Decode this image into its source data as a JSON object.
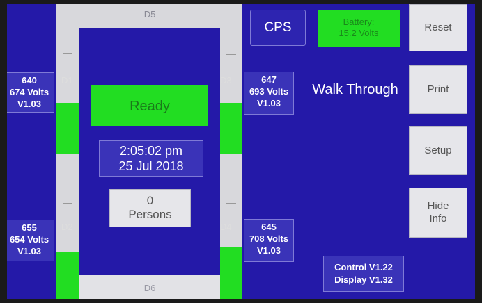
{
  "header": {
    "cps_label": "CPS",
    "battery_line1": "Battery:",
    "battery_line2": "15.2 Volts"
  },
  "status": {
    "ready_label": "Ready",
    "time": "2:05:02 pm",
    "date": "25 Jul 2018",
    "persons_count": "0",
    "persons_label": "Persons",
    "mode_label": "Walk Through"
  },
  "detectors": {
    "d1": {
      "label": "D1",
      "id": "640",
      "volts": "674 Volts",
      "version": "V1.03"
    },
    "d2": {
      "label": "D2",
      "id": "655",
      "volts": "654 Volts",
      "version": "V1.03"
    },
    "d3": {
      "label": "D3",
      "id": "647",
      "volts": "693 Volts",
      "version": "V1.03"
    },
    "d4": {
      "label": "D4",
      "id": "645",
      "volts": "708 Volts",
      "version": "V1.03"
    },
    "d5": {
      "label": "D5"
    },
    "d6": {
      "label": "D6"
    }
  },
  "buttons": {
    "reset": "Reset",
    "print": "Print",
    "setup": "Setup",
    "hide_info_line1": "Hide",
    "hide_info_line2": "Info"
  },
  "versions": {
    "control": "Control V1.22",
    "display": "Display V1.32"
  },
  "colors": {
    "screen_bg": "#2419a8",
    "active_green": "#22dd22",
    "bar_grey": "#d8d8dc"
  }
}
